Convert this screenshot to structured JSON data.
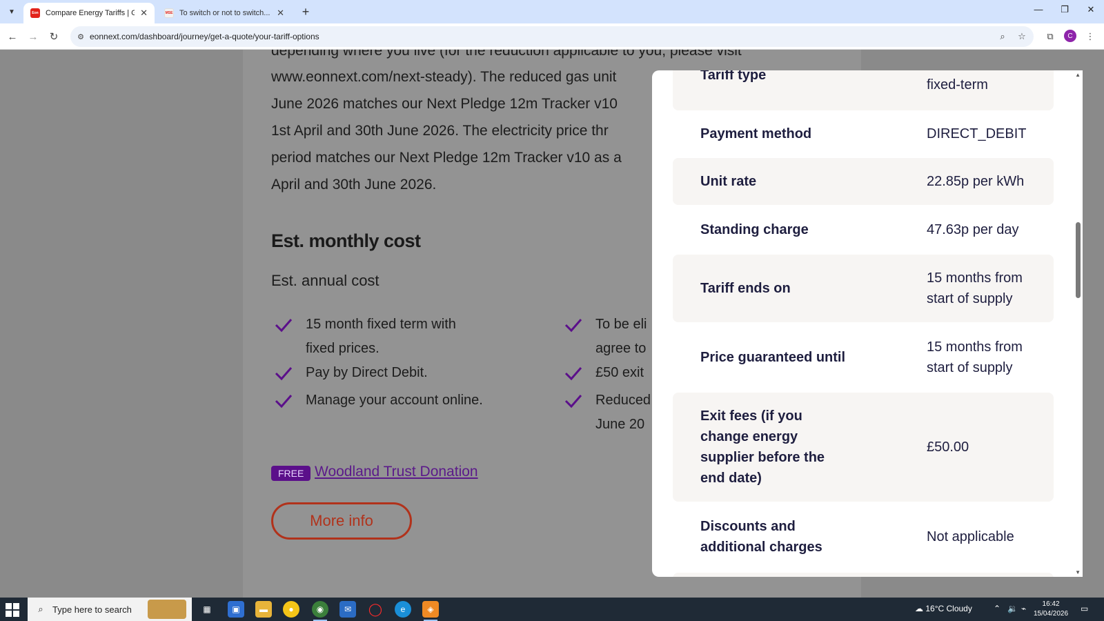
{
  "browser": {
    "tabs": [
      {
        "title": "Compare Energy Tariffs | Get a Q",
        "favicon": "Eon"
      },
      {
        "title": "To switch or not to switch... — M",
        "favicon": "MSE"
      }
    ],
    "url": "eonnext.com/dashboard/journey/get-a-quote/your-tariff-options",
    "profile_initial": "C"
  },
  "page": {
    "body_lines": [
      "depending where you live (for the reduction applicable to you, please visit",
      "www.eonnext.com/next-steady). The reduced gas unit",
      "June 2026 matches our Next Pledge 12m Tracker v10",
      "1st April and 30th June 2026. The electricity price thr",
      "period matches our Next Pledge 12m Tracker v10 as a",
      "April and 30th June 2026."
    ],
    "heading": "Est. monthly cost",
    "subheading": "Est. annual cost",
    "features_left": [
      {
        "line1": "15 month fixed term with",
        "line2": "fixed prices."
      },
      {
        "line1": "Pay by Direct Debit.",
        "line2": ""
      },
      {
        "line1": "Manage your account online.",
        "line2": ""
      }
    ],
    "features_right": [
      {
        "line1": "To be eli",
        "line2": "agree to"
      },
      {
        "line1": "£50 exit",
        "line2": ""
      },
      {
        "line1": "Reduced",
        "line2": "June 20"
      }
    ],
    "free_badge": "FREE",
    "donation_link": "Woodland Trust Donation",
    "more_info": "More info"
  },
  "modal": {
    "rows": [
      {
        "label": "Tariff type",
        "value": "fixed-term"
      },
      {
        "label": "Payment method",
        "value": "DIRECT_DEBIT"
      },
      {
        "label": "Unit rate",
        "value": "22.85p per kWh"
      },
      {
        "label": "Standing charge",
        "value": "47.63p per day"
      },
      {
        "label": "Tariff ends on",
        "value_line1": "15 months from",
        "value_line2": "start of supply"
      },
      {
        "label": "Price guaranteed until",
        "value_line1": "15 months from",
        "value_line2": "start of supply"
      },
      {
        "label_lines": [
          "Exit fees (if you",
          "change energy",
          "supplier before the",
          "end date)"
        ],
        "value": "£50.00"
      },
      {
        "label_lines": [
          "Discounts and",
          "additional charges"
        ],
        "value": "Not applicable"
      }
    ]
  },
  "taskbar": {
    "search_placeholder": "Type here to search",
    "weather": "16°C  Cloudy",
    "time": "16:42",
    "date": "15/04/2026"
  },
  "colors": {
    "check": "#5b0f8a",
    "brand_red": "#b1321b",
    "modal_text": "#1e1e3f"
  }
}
